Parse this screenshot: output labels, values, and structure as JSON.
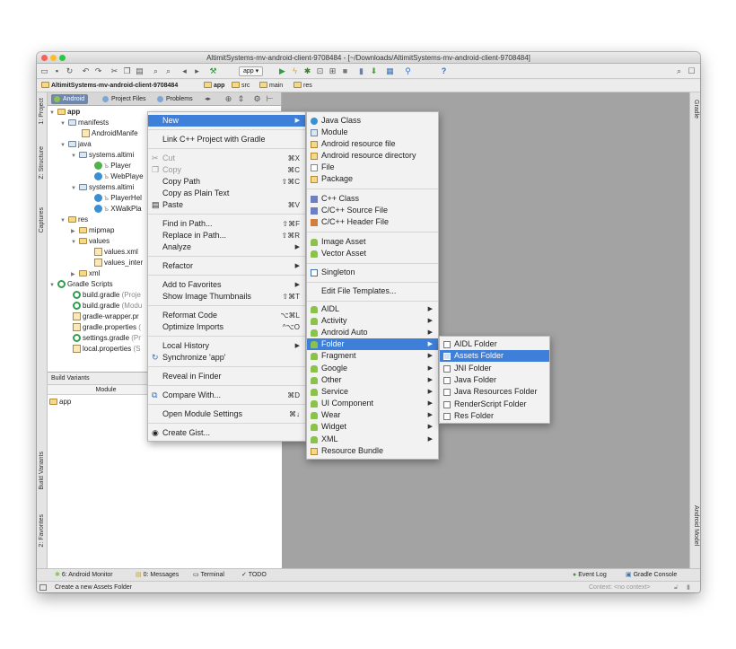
{
  "window": {
    "title": "AltimitSystems-mv-android-client-9708484 - [~/Downloads/AltimitSystems-mv-android-client-9708484]"
  },
  "toolbar": {
    "run_config": "app",
    "help": "?"
  },
  "breadcrumb": [
    "AltimitSystems-mv-android-client-9708484",
    "app",
    "src",
    "main",
    "res"
  ],
  "left_tabs": {
    "project": "1: Project",
    "structure": "Z: Structure",
    "captures": "Captures",
    "build_variants": "Build Variants",
    "favorites": "2: Favorites"
  },
  "right_tabs": {
    "gradle": "Gradle",
    "android_model": "Android Model"
  },
  "project_tabs": [
    "Android",
    "Project Files",
    "Problems"
  ],
  "tree": [
    {
      "label": "app",
      "icon": "module-folder"
    },
    {
      "label": "manifests",
      "icon": "folder"
    },
    {
      "label": "AndroidManife",
      "icon": "xml-file"
    },
    {
      "label": "java",
      "icon": "folder"
    },
    {
      "label": "systems.altimi",
      "icon": "package"
    },
    {
      "label": "Player",
      "icon": "interface"
    },
    {
      "label": "WebPlaye",
      "icon": "class"
    },
    {
      "label": "systems.altimi",
      "icon": "package"
    },
    {
      "label": "PlayerHel",
      "icon": "class"
    },
    {
      "label": "XWalkPla",
      "icon": "class"
    },
    {
      "label": "res",
      "icon": "res-folder"
    },
    {
      "label": "mipmap",
      "icon": "folder"
    },
    {
      "label": "values",
      "icon": "folder"
    },
    {
      "label": "values.xml",
      "icon": "xml-file"
    },
    {
      "label": "values_inter",
      "icon": "xml-file"
    },
    {
      "label": "xml",
      "icon": "folder"
    },
    {
      "label": "Gradle Scripts",
      "icon": "gradle"
    },
    {
      "label": "build.gradle",
      "suffix": "(Proje",
      "icon": "gradle"
    },
    {
      "label": "build.gradle",
      "suffix": "(Modu",
      "icon": "gradle"
    },
    {
      "label": "gradle-wrapper.pr",
      "icon": "file"
    },
    {
      "label": "gradle.properties",
      "suffix": "(",
      "icon": "file"
    },
    {
      "label": "settings.gradle",
      "suffix": "(Pr",
      "icon": "gradle"
    },
    {
      "label": "local.properties",
      "suffix": "(S",
      "icon": "file"
    }
  ],
  "build_variants": {
    "title": "Build Variants",
    "column": "Module",
    "rows": [
      "app"
    ]
  },
  "context_menu": [
    {
      "label": "New",
      "submenu": true,
      "selected": true
    },
    {
      "label": "Link C++ Project with Gradle"
    },
    {
      "label": "Cut",
      "shortcut": "⌘X",
      "disabled": true,
      "icon": "scissors"
    },
    {
      "label": "Copy",
      "shortcut": "⌘C",
      "disabled": true,
      "icon": "copy"
    },
    {
      "label": "Copy Path",
      "shortcut": "⇧⌘C"
    },
    {
      "label": "Copy as Plain Text"
    },
    {
      "label": "Paste",
      "shortcut": "⌘V",
      "icon": "paste"
    },
    {
      "label": "Find in Path...",
      "shortcut": "⇧⌘F"
    },
    {
      "label": "Replace in Path...",
      "shortcut": "⇧⌘R"
    },
    {
      "label": "Analyze",
      "submenu": true
    },
    {
      "label": "Refactor",
      "submenu": true
    },
    {
      "label": "Add to Favorites",
      "submenu": true
    },
    {
      "label": "Show Image Thumbnails",
      "shortcut": "⇧⌘T"
    },
    {
      "label": "Reformat Code",
      "shortcut": "⌥⌘L"
    },
    {
      "label": "Optimize Imports",
      "shortcut": "^⌥O"
    },
    {
      "label": "Local History",
      "submenu": true
    },
    {
      "label": "Synchronize 'app'",
      "icon": "sync"
    },
    {
      "label": "Reveal in Finder"
    },
    {
      "label": "Compare With...",
      "shortcut": "⌘D",
      "icon": "compare"
    },
    {
      "label": "Open Module Settings",
      "shortcut": "⌘↓"
    },
    {
      "label": "Create Gist...",
      "icon": "github"
    }
  ],
  "new_menu": [
    {
      "label": "Java Class",
      "icon": "class"
    },
    {
      "label": "Module",
      "icon": "module"
    },
    {
      "label": "Android resource file",
      "icon": "res"
    },
    {
      "label": "Android resource directory",
      "icon": "res"
    },
    {
      "label": "File",
      "icon": "file"
    },
    {
      "label": "Package",
      "icon": "package"
    },
    {
      "label": "C++ Class",
      "icon": "cpp"
    },
    {
      "label": "C/C++ Source File",
      "icon": "cpp"
    },
    {
      "label": "C/C++ Header File",
      "icon": "cpp"
    },
    {
      "label": "Image Asset",
      "icon": "android"
    },
    {
      "label": "Vector Asset",
      "icon": "android"
    },
    {
      "label": "Singleton",
      "icon": "singleton"
    },
    {
      "label": "Edit File Templates..."
    },
    {
      "label": "AIDL",
      "icon": "android",
      "submenu": true
    },
    {
      "label": "Activity",
      "icon": "android",
      "submenu": true
    },
    {
      "label": "Android Auto",
      "icon": "android",
      "submenu": true
    },
    {
      "label": "Folder",
      "icon": "android",
      "submenu": true,
      "selected": true
    },
    {
      "label": "Fragment",
      "icon": "android",
      "submenu": true
    },
    {
      "label": "Google",
      "icon": "android",
      "submenu": true
    },
    {
      "label": "Other",
      "icon": "android",
      "submenu": true
    },
    {
      "label": "Service",
      "icon": "android",
      "submenu": true
    },
    {
      "label": "UI Component",
      "icon": "android",
      "submenu": true
    },
    {
      "label": "Wear",
      "icon": "android",
      "submenu": true
    },
    {
      "label": "Widget",
      "icon": "android",
      "submenu": true
    },
    {
      "label": "XML",
      "icon": "android",
      "submenu": true
    },
    {
      "label": "Resource Bundle",
      "icon": "bundle"
    }
  ],
  "folder_menu": [
    {
      "label": "AIDL Folder"
    },
    {
      "label": "Assets Folder",
      "selected": true
    },
    {
      "label": "JNI Folder"
    },
    {
      "label": "Java Folder"
    },
    {
      "label": "Java Resources Folder"
    },
    {
      "label": "RenderScript Folder"
    },
    {
      "label": "Res Folder"
    }
  ],
  "bottom_tabs": {
    "monitor": "6: Android Monitor",
    "messages": "0: Messages",
    "terminal": "Terminal",
    "todo": "TODO",
    "event_log": "Event Log",
    "gradle_console": "Gradle Console"
  },
  "status": {
    "message": "Create a new Assets Folder",
    "context": "Context: <no context>"
  },
  "colors": {
    "selection": "#3d7fd9",
    "android_green": "#8ac24a"
  }
}
